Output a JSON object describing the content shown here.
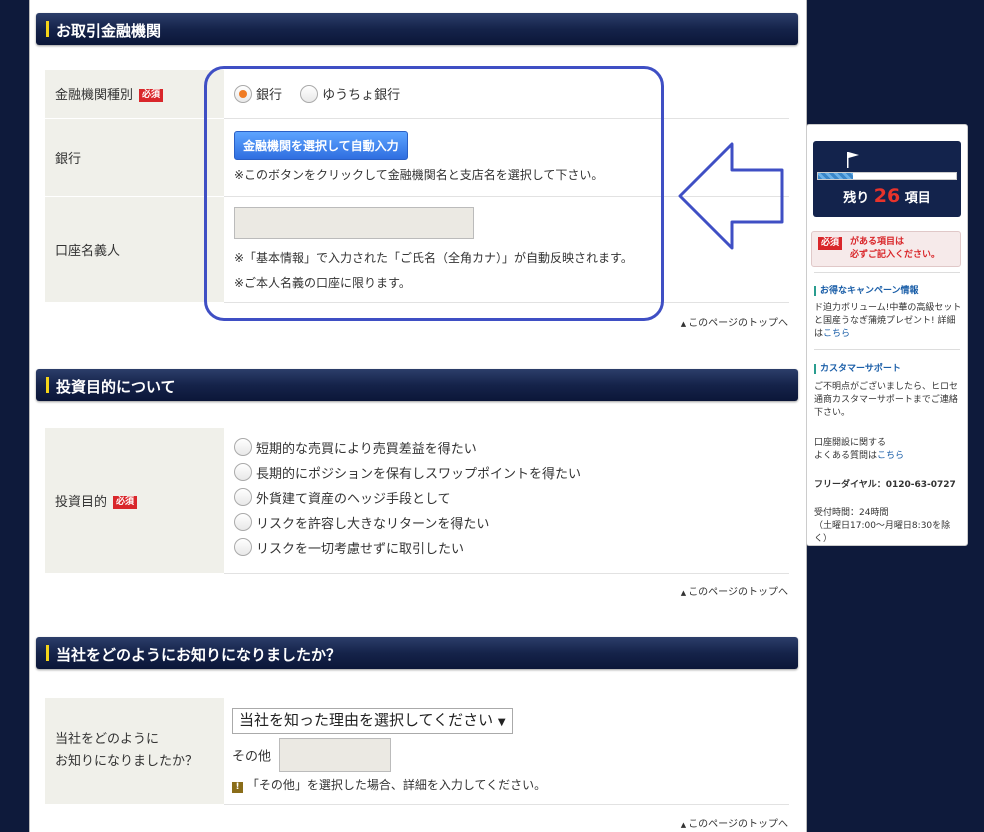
{
  "sections": {
    "bank": {
      "title": "お取引金融機関",
      "rows": {
        "type": {
          "label": "金融機関種別",
          "required": "必須",
          "options": [
            "銀行",
            "ゆうちょ銀行"
          ],
          "selected": "銀行"
        },
        "bank": {
          "label": "銀行",
          "button": "金融機関を選択して自動入力",
          "note": "※このボタンをクリックして金融機関名と支店名を選択して下さい。"
        },
        "holder": {
          "label": "口座名義人",
          "value": "",
          "note1": "※「基本情報」で入力された「ご氏名（全角カナ）」が自動反映されます。",
          "note2": "※ご本人名義の口座に限ります。"
        }
      },
      "to_top": "このページのトップへ"
    },
    "purpose": {
      "title": "投資目的について",
      "label": "投資目的",
      "required": "必須",
      "options": [
        "短期的な売買により売買差益を得たい",
        "長期的にポジションを保有しスワップポイントを得たい",
        "外貨建て資産のヘッジ手段として",
        "リスクを許容し大きなリターンを得たい",
        "リスクを一切考慮せずに取引したい"
      ],
      "to_top": "このページのトップへ"
    },
    "source": {
      "title": "当社をどのようにお知りになりましたか？",
      "label_line1": "当社をどのように",
      "label_line2": "お知りになりましたか？",
      "select_value": "当社を知った理由を選択してください",
      "other_label": "その他",
      "other_value": "",
      "warn_icon": "!",
      "note": "「その他」を選択した場合、詳細を入力してください。",
      "to_top": "このページのトップへ"
    }
  },
  "sidebar": {
    "remaining_prefix": "残り",
    "remaining_count": "26",
    "remaining_suffix": "項目",
    "progress": 0.25,
    "required_badge": "必須",
    "warn_line1": "がある項目は",
    "warn_line2": "必ずご記入ください。",
    "campaign_title": "お得なキャンペーン情報",
    "campaign_text": "ド迫力ボリューム!中華の高級セットと国産うなぎ蒲焼プレゼント! 詳細は",
    "campaign_link": "こちら",
    "support_title": "カスタマーサポート",
    "support_text": "ご不明点がございましたら、ヒロセ通商カスタマーサポートまでご連絡下さい。",
    "faq_text1": "口座開設に関する",
    "faq_text2": "よくある質問は",
    "faq_link": "こちら",
    "freedial": "フリーダイヤル：0120-63-0727",
    "hours1": "受付時間：24時間",
    "hours2": "（土曜日17:00〜月曜日8:30を除く）"
  },
  "colors": {
    "background": "#0e1a3b",
    "accent_orange": "#f07b23",
    "required_red": "#d9262a",
    "annotation_blue": "#3f4fc4"
  }
}
